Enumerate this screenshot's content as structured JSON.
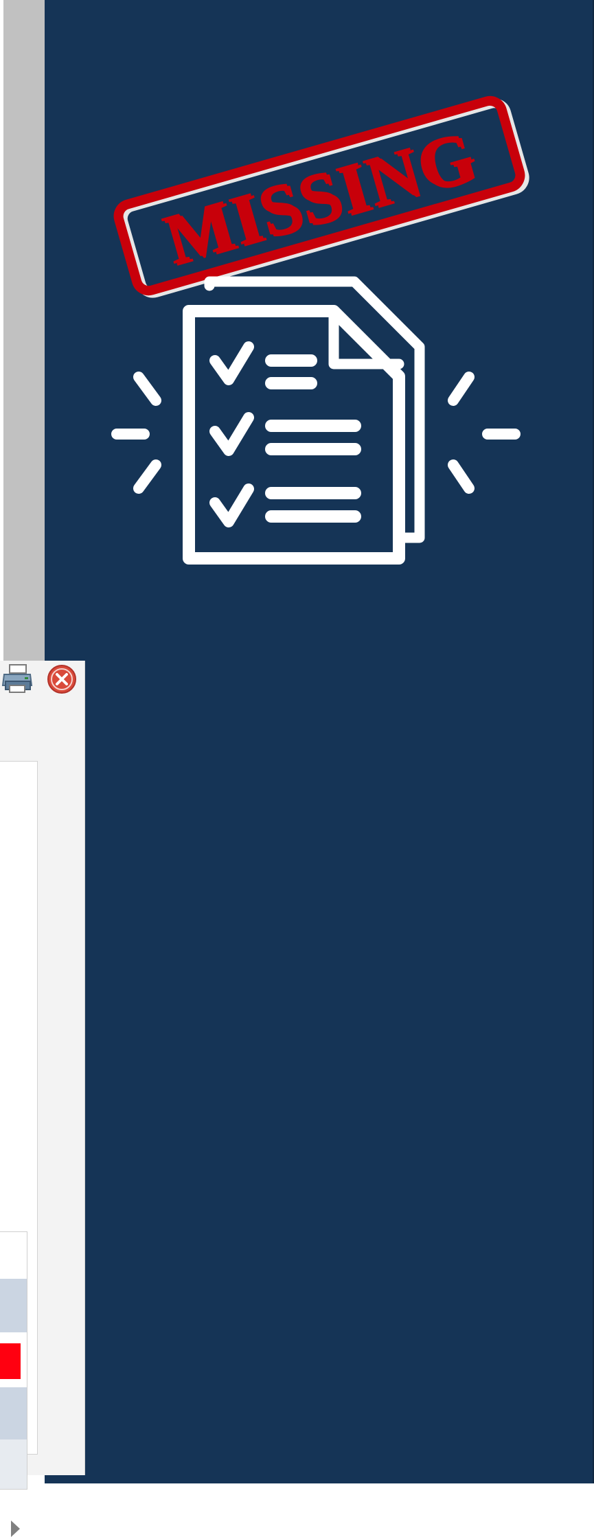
{
  "illustration": {
    "stamp_text": "MISSING",
    "stamp_color": "#c8000a",
    "icon": "checklist-document-icon"
  },
  "colors": {
    "background_panel": "#153456",
    "gray_strip": "#c1c1c1",
    "dialog_background": "#f3f3f3",
    "grid_row_highlight": "#cbd5e2",
    "grid_cell_flag": "#ff0010"
  },
  "dialog": {
    "toolbar": {
      "print_icon": "printer-icon",
      "close_icon": "close-icon"
    },
    "grid": {
      "rows": [
        {
          "flagged": false
        },
        {
          "flagged": true
        },
        {
          "flagged": false
        },
        {
          "flagged": false
        }
      ]
    },
    "scroll_icon": "scroll-right-arrow-icon"
  }
}
